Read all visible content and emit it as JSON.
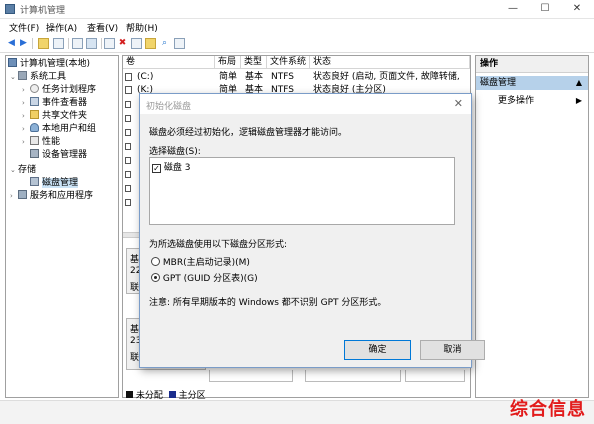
{
  "window": {
    "title": "计算机管理",
    "controls": {
      "minimize": "—",
      "maximize": "☐",
      "close": "✕"
    }
  },
  "menu": [
    "文件(F)",
    "操作(A)",
    "查看(V)",
    "帮助(H)"
  ],
  "tree": {
    "root": "计算机管理(本地)",
    "system_tools": "系统工具",
    "task_scheduler": "任务计划程序",
    "event_viewer": "事件查看器",
    "shared_folders": "共享文件夹",
    "local_users": "本地用户和组",
    "performance": "性能",
    "device_manager": "设备管理器",
    "storage": "存储",
    "disk_management": "磁盘管理",
    "services_apps": "服务和应用程序"
  },
  "volume_list": {
    "headers": {
      "volume": "卷",
      "layout": "布局",
      "type": "类型",
      "fs": "文件系统",
      "status": "状态"
    },
    "rows": [
      {
        "volume": "(C:)",
        "layout": "简单",
        "type": "基本",
        "fs": "NTFS",
        "status": "状态良好 (启动, 页面文件, 故障转储,"
      },
      {
        "volume": "(K:)",
        "layout": "简单",
        "type": "基本",
        "fs": "NTFS",
        "status": "状态良好 (主分区)"
      }
    ]
  },
  "disk_map": {
    "disk2": {
      "l1": "基",
      "l2": "22",
      "l3": "联"
    },
    "disk3": {
      "l1": "基",
      "l2": "23",
      "l3": "联"
    }
  },
  "legend": {
    "unallocated": "未分配",
    "primary": "主分区"
  },
  "actions": {
    "header": "操作",
    "selected": "磁盘管理",
    "more": "更多操作"
  },
  "dialog": {
    "title": "初始化磁盘",
    "message": "磁盘必须经过初始化，逻辑磁盘管理器才能访问。",
    "select_label": "选择磁盘(S):",
    "disk_item": "磁盘 3",
    "partition_label": "为所选磁盘使用以下磁盘分区形式:",
    "mbr_option": "MBR(主启动记录)(M)",
    "gpt_option": "GPT (GUID 分区表)(G)",
    "selected_option": "gpt",
    "note": "注意: 所有早期版本的 Windows 都不识别 GPT 分区形式。",
    "ok": "确定",
    "cancel": "取消"
  },
  "watermark": "综合信息"
}
